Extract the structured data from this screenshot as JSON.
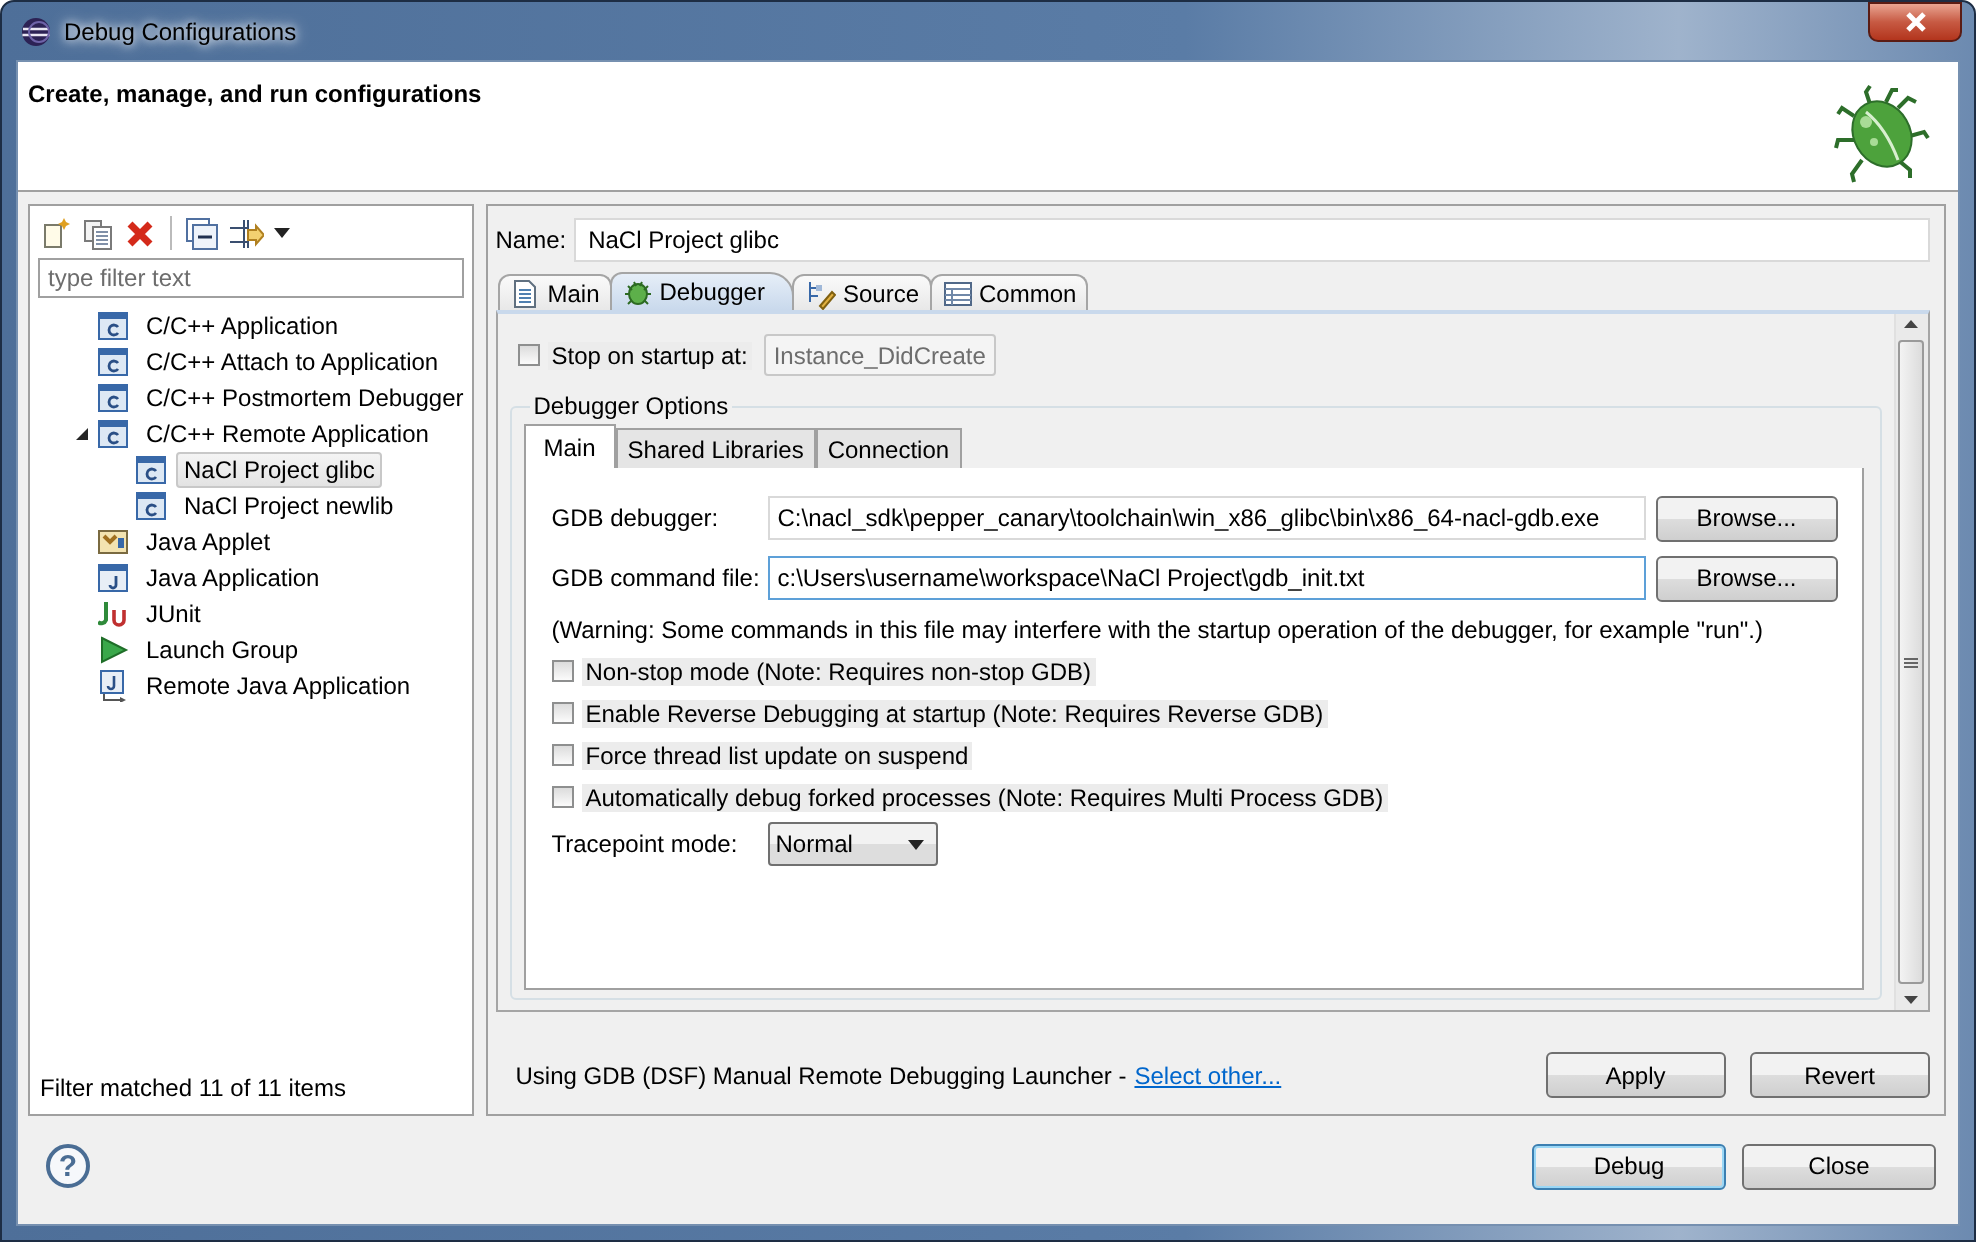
{
  "window": {
    "title": "Debug Configurations"
  },
  "header": {
    "title": "Create, manage, and run configurations"
  },
  "sidebar": {
    "filter": {
      "placeholder": "type filter text"
    },
    "tree": [
      {
        "label": "C/C++ Application",
        "kind": "c",
        "selected": false
      },
      {
        "label": "C/C++ Attach to Application",
        "kind": "c",
        "selected": false
      },
      {
        "label": "C/C++ Postmortem Debugger",
        "kind": "c",
        "selected": false
      },
      {
        "label": "C/C++ Remote Application",
        "kind": "c",
        "selected": false,
        "expanded": true,
        "children": [
          {
            "label": "NaCl Project glibc",
            "kind": "c",
            "selected": true
          },
          {
            "label": "NaCl Project newlib",
            "kind": "c",
            "selected": false
          }
        ]
      },
      {
        "label": "Java Applet",
        "kind": "applet",
        "selected": false
      },
      {
        "label": "Java Application",
        "kind": "java",
        "selected": false
      },
      {
        "label": "JUnit",
        "kind": "junit",
        "selected": false
      },
      {
        "label": "Launch Group",
        "kind": "launch",
        "selected": false
      },
      {
        "label": "Remote Java Application",
        "kind": "remote",
        "selected": false
      }
    ],
    "status": "Filter matched 11 of 11 items"
  },
  "editor": {
    "name_label": "Name:",
    "name": "NaCl Project glibc",
    "tabs": [
      {
        "label": "Main",
        "kind": "page",
        "selected": false
      },
      {
        "label": "Debugger",
        "kind": "bug",
        "selected": true
      },
      {
        "label": "Source",
        "kind": "source",
        "selected": false
      },
      {
        "label": "Common",
        "kind": "table",
        "selected": false
      }
    ],
    "stop_on_startup": {
      "label": "Stop on startup at:",
      "checked": false,
      "value": "Instance_DidCreate",
      "disabled": true
    },
    "options": {
      "title": "Debugger Options",
      "tabs": [
        {
          "label": "Main",
          "selected": true
        },
        {
          "label": "Shared Libraries",
          "selected": false
        },
        {
          "label": "Connection",
          "selected": false
        }
      ],
      "fields": [
        {
          "label": "GDB debugger:",
          "value": "C:\\nacl_sdk\\pepper_canary\\toolchain\\win_x86_glibc\\bin\\x86_64-nacl-gdb.exe",
          "button": "Browse...",
          "focused": false
        },
        {
          "label": "GDB command file:",
          "value": "c:\\Users\\username\\workspace\\NaCl Project\\gdb_init.txt",
          "button": "Browse...",
          "focused": true
        }
      ],
      "warning": "(Warning: Some commands in this file may interfere with the startup operation of the debugger, for example \"run\".)",
      "checkboxes": [
        {
          "label": "Non-stop mode (Note: Requires non-stop GDB)",
          "checked": false
        },
        {
          "label": "Enable Reverse Debugging at startup (Note: Requires Reverse GDB)",
          "checked": false
        },
        {
          "label": "Force thread list update on suspend",
          "checked": false
        },
        {
          "label": "Automatically debug forked processes (Note: Requires Multi Process GDB)",
          "checked": false
        }
      ],
      "tracepoint": {
        "label": "Tracepoint mode:",
        "value": "Normal"
      }
    },
    "launcher": {
      "text": "Using GDB (DSF) Manual Remote Debugging Launcher -",
      "link": "Select other..."
    },
    "buttons": [
      "Apply",
      "Revert"
    ]
  },
  "footer": {
    "help": "?",
    "buttons": [
      {
        "label": "Debug",
        "default": true
      },
      {
        "label": "Close",
        "default": false
      }
    ]
  }
}
